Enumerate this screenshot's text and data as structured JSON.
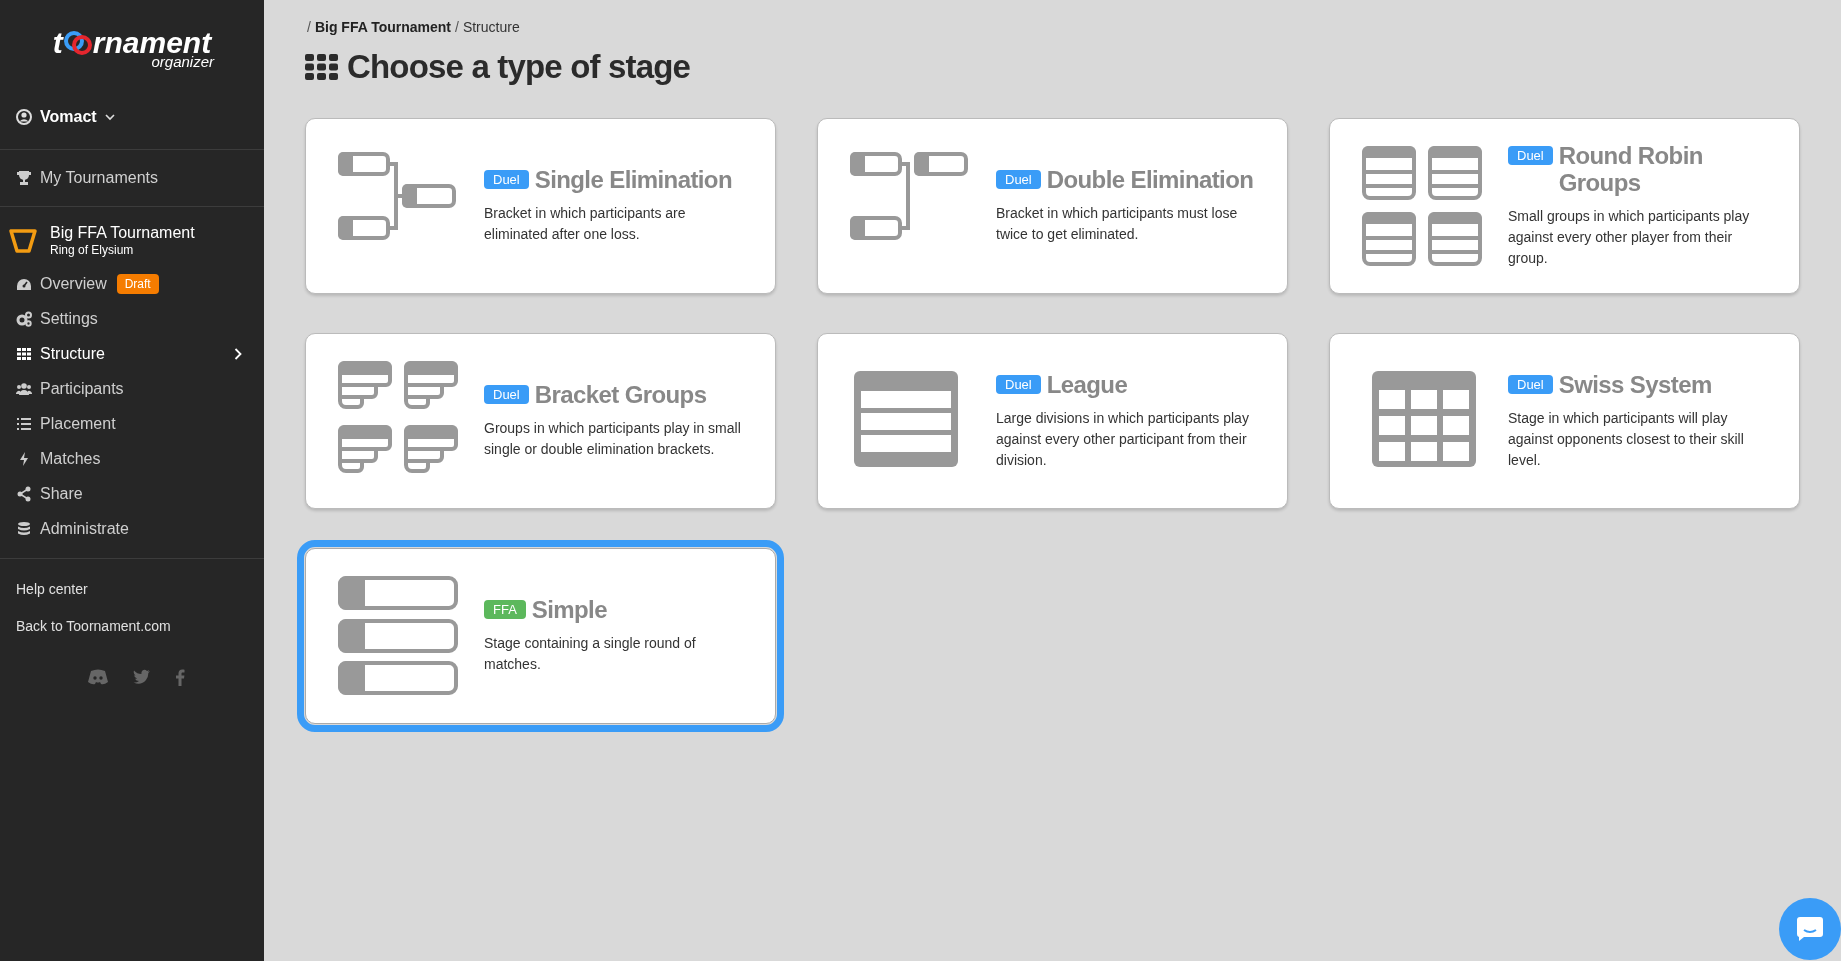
{
  "sidebar": {
    "logo": {
      "prefix": "t",
      "suffix": "rnament",
      "subtitle": "organizer"
    },
    "user": {
      "name": "Vomact"
    },
    "my_tournaments": {
      "label": "My Tournaments"
    },
    "tournament": {
      "name": "Big FFA Tournament",
      "game": "Ring of Elysium"
    },
    "items": [
      {
        "kind": "overview",
        "label": "Overview",
        "badge": "Draft",
        "selected": false
      },
      {
        "kind": "settings",
        "label": "Settings",
        "selected": false
      },
      {
        "kind": "structure",
        "label": "Structure",
        "selected": true
      },
      {
        "kind": "participants",
        "label": "Participants",
        "selected": false
      },
      {
        "kind": "placement",
        "label": "Placement",
        "selected": false
      },
      {
        "kind": "matches",
        "label": "Matches",
        "selected": false
      },
      {
        "kind": "share",
        "label": "Share",
        "selected": false
      },
      {
        "kind": "administrate",
        "label": "Administrate",
        "selected": false
      }
    ],
    "links": [
      "Help center",
      "Back to Toornament.com"
    ]
  },
  "breadcrumb": [
    {
      "separator": "/",
      "label": "Big FFA Tournament",
      "kind": "link"
    },
    {
      "separator": "/",
      "label": "Structure",
      "kind": "current"
    }
  ],
  "title": "Choose a type of stage",
  "stages": [
    {
      "kind": "single",
      "badge": "Duel",
      "color": "#3a9cf7",
      "name": "Single Elimination",
      "description": "Bracket in which participants are eliminated after one loss.",
      "selected": false
    },
    {
      "kind": "double",
      "badge": "Duel",
      "color": "#3a9cf7",
      "name": "Double Elimination",
      "description": "Bracket in which participants must lose twice to get eliminated.",
      "selected": false
    },
    {
      "kind": "roundrobin",
      "badge": "Duel",
      "color": "#3a9cf7",
      "name": "Round Robin Groups",
      "description": "Small groups in which participants play against every other player from their group.",
      "selected": false
    },
    {
      "kind": "bracketgroups",
      "badge": "Duel",
      "color": "#3a9cf7",
      "name": "Bracket Groups",
      "description": "Groups in which participants play in small single or double elimination brackets.",
      "selected": false
    },
    {
      "kind": "league",
      "badge": "Duel",
      "color": "#3a9cf7",
      "name": "League",
      "description": "Large divisions in which participants play against every other participant from their division.",
      "selected": false
    },
    {
      "kind": "swiss",
      "badge": "Duel",
      "color": "#3a9cf7",
      "name": "Swiss System",
      "description": "Stage in which participants will play against opponents closest to their skill level.",
      "selected": false
    },
    {
      "kind": "simple",
      "badge": "FFA",
      "color": "#5cb85c",
      "name": "Simple",
      "description": "Stage containing a single round of matches.",
      "selected": true
    }
  ]
}
